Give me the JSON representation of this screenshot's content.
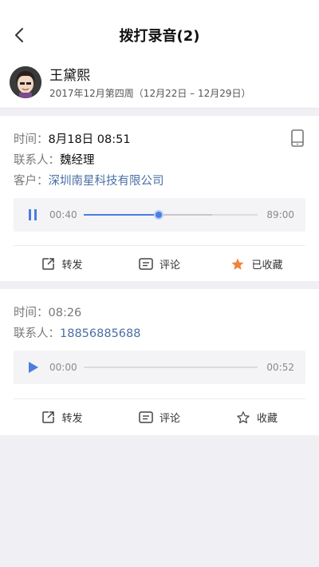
{
  "header": {
    "title": "拨打录音(2)"
  },
  "user": {
    "name": "王黛熙",
    "week": "2017年12月第四周（12月22日 – 12月29日）"
  },
  "labels": {
    "time": "时间：",
    "contact": "联系人：",
    "customer": "客户："
  },
  "records": [
    {
      "time": "8月18日  08:51",
      "contact": "魏经理",
      "customer": "深圳南星科技有限公司",
      "player": {
        "state": "playing",
        "current": "00:40",
        "total": "89:00",
        "progress": 0.43,
        "buffered": 0.74
      },
      "actions": {
        "forward": "转发",
        "comment": "评论",
        "favorite": "已收藏",
        "favorited": true
      },
      "colors": {
        "favorite": "#f0843a"
      }
    },
    {
      "time": "08:26",
      "contact": "18856885688",
      "player": {
        "state": "paused",
        "current": "00:00",
        "total": "00:52",
        "progress": 0.0,
        "buffered": 0.0
      },
      "actions": {
        "forward": "转发",
        "comment": "评论",
        "favorite": "收藏",
        "favorited": false
      }
    }
  ],
  "colors": {
    "accent": "#4a7de0",
    "link": "#4a6fa5",
    "background": "#efeff4"
  }
}
